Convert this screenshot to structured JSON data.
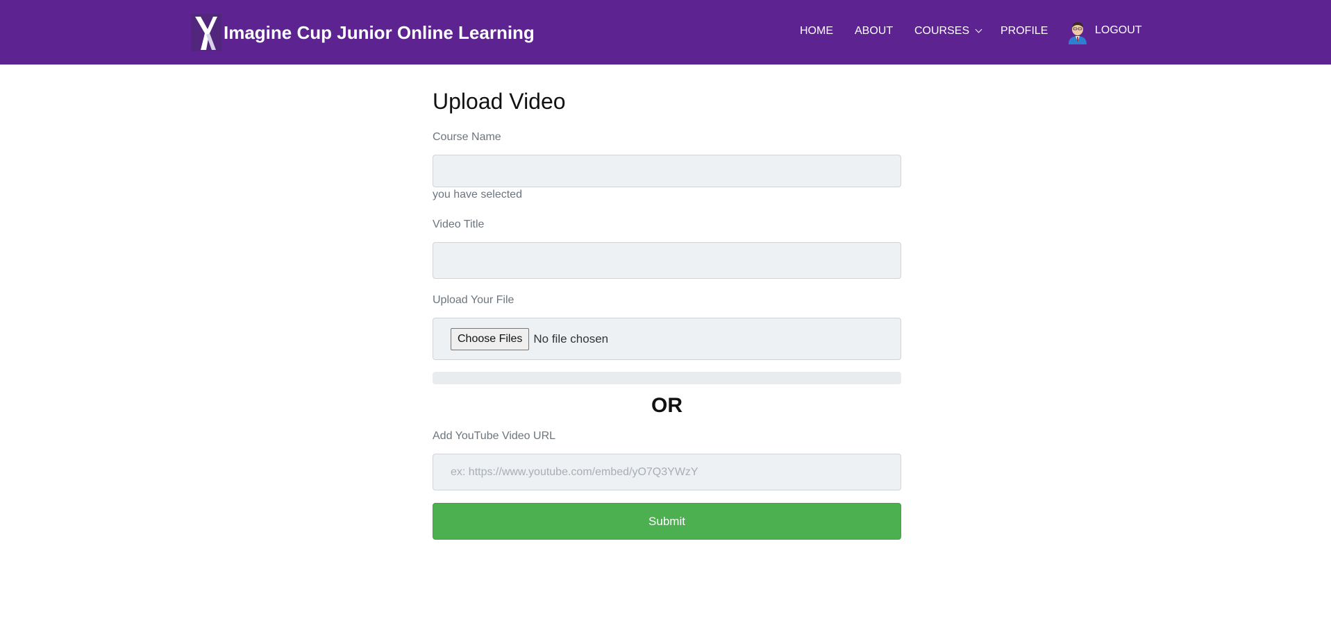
{
  "brand": {
    "title": "Imagine Cup Junior Online Learning",
    "logo_icon": "imagine-cup-logo-icon"
  },
  "nav": {
    "home": "HOME",
    "about": "ABOUT",
    "courses": "COURSES",
    "profile": "PROFILE",
    "logout": "LOGOUT",
    "avatar_icon": "user-avatar-icon"
  },
  "page": {
    "title": "Upload Video"
  },
  "form": {
    "course_name_label": "Course Name",
    "course_name_value": "",
    "course_help": "you have selected",
    "video_title_label": "Video Title",
    "video_title_value": "",
    "upload_label": "Upload Your File",
    "choose_files": "Choose Files",
    "no_file": "No file chosen",
    "upload_progress_percent": 0,
    "or": "OR",
    "youtube_label": "Add YouTube Video URL",
    "youtube_placeholder": "ex: https://www.youtube.com/embed/yO7Q3YWzY",
    "youtube_value": "",
    "submit": "Submit"
  },
  "colors": {
    "navbar": "#5c2391",
    "submit": "#4caf50",
    "input_bg": "#eef1f4"
  }
}
